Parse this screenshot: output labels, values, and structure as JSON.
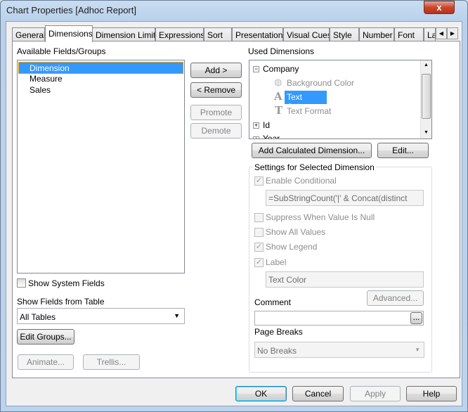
{
  "window": {
    "title": "Chart Properties [Adhoc Report]",
    "close_glyph": "x"
  },
  "tabs": [
    "General",
    "Dimensions",
    "Dimension Limits",
    "Expressions",
    "Sort",
    "Presentation",
    "Visual Cues",
    "Style",
    "Number",
    "Font",
    "La"
  ],
  "active_tab": "Dimensions",
  "available": {
    "label": "Available Fields/Groups",
    "items": [
      "Dimension",
      "Measure",
      "Sales"
    ],
    "selected": "Dimension"
  },
  "show_system_fields": {
    "label": "Show System Fields",
    "checked": false
  },
  "show_fields_from_table": {
    "label": "Show Fields from Table",
    "value": "All Tables"
  },
  "buttons": {
    "edit_groups": "Edit Groups...",
    "animate": "Animate...",
    "trellis": "Trellis...",
    "add": "Add >",
    "remove": "< Remove",
    "promote": "Promote",
    "demote": "Demote",
    "add_calculated": "Add Calculated Dimension...",
    "edit": "Edit...",
    "advanced": "Advanced...",
    "ellipsis": "...",
    "ok": "OK",
    "cancel": "Cancel",
    "apply": "Apply",
    "help": "Help"
  },
  "used": {
    "label": "Used Dimensions",
    "tree": {
      "company": "Company",
      "children": [
        "Background Color",
        "Text Color",
        "Text Format"
      ],
      "selected": "Text Color",
      "id": "Id",
      "year": "Year"
    }
  },
  "settings": {
    "title": "Settings for Selected Dimension",
    "enable_conditional": "Enable Conditional",
    "conditional_expr": "=SubStringCount('|' & Concat(distinct",
    "suppress_null": "Suppress When Value Is Null",
    "show_all_values": "Show All Values",
    "show_legend": "Show Legend",
    "label": "Label",
    "label_value": "Text Color",
    "comment": "Comment",
    "comment_value": "",
    "page_breaks": "Page Breaks",
    "page_breaks_value": "No Breaks"
  },
  "colors": {
    "selection": "#3399ff",
    "accent": "#3c7fb1"
  }
}
